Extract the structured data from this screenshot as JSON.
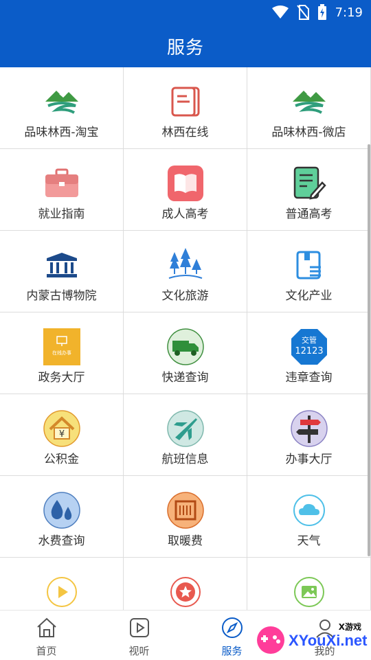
{
  "status_bar": {
    "time": "7:19",
    "icons": [
      "wifi-icon",
      "no-sim-icon",
      "battery-icon"
    ]
  },
  "app_bar": {
    "title": "服务"
  },
  "services": [
    {
      "label": "品味林西-淘宝",
      "icon": "mountain-logo-icon"
    },
    {
      "label": "林西在线",
      "icon": "news-doc-icon"
    },
    {
      "label": "品味林西-微店",
      "icon": "mountain-logo-icon"
    },
    {
      "label": "就业指南",
      "icon": "briefcase-icon"
    },
    {
      "label": "成人高考",
      "icon": "open-book-icon"
    },
    {
      "label": "普通高考",
      "icon": "exam-paper-icon"
    },
    {
      "label": "内蒙古博物院",
      "icon": "museum-icon"
    },
    {
      "label": "文化旅游",
      "icon": "trees-icon"
    },
    {
      "label": "文化产业",
      "icon": "document-list-icon"
    },
    {
      "label": "政务大厅",
      "icon": "online-service-icon",
      "badge": "在线办事"
    },
    {
      "label": "快递查询",
      "icon": "delivery-truck-icon"
    },
    {
      "label": "违章查询",
      "icon": "traffic-12123-icon",
      "badge_top": "交管",
      "badge_num": "12123"
    },
    {
      "label": "公积金",
      "icon": "house-yuan-icon"
    },
    {
      "label": "航班信息",
      "icon": "airplane-icon"
    },
    {
      "label": "办事大厅",
      "icon": "signpost-icon"
    },
    {
      "label": "水费查询",
      "icon": "water-drops-icon"
    },
    {
      "label": "取暖费",
      "icon": "heater-icon"
    },
    {
      "label": "天气",
      "icon": "cloud-icon"
    },
    {
      "label": "",
      "icon": "play-circle-icon"
    },
    {
      "label": "",
      "icon": "star-circle-icon"
    },
    {
      "label": "",
      "icon": "image-circle-icon"
    }
  ],
  "bottom_nav": [
    {
      "label": "首页",
      "icon": "home-icon",
      "active": false
    },
    {
      "label": "视听",
      "icon": "play-square-icon",
      "active": false
    },
    {
      "label": "服务",
      "icon": "compass-icon",
      "active": true
    },
    {
      "label": "我的",
      "icon": "user-icon",
      "active": false
    }
  ],
  "watermark": {
    "brand": "XYouXi.net",
    "small": "X游戏"
  },
  "colors": {
    "primary": "#0b5cc8",
    "divider": "#dcdcdc"
  }
}
